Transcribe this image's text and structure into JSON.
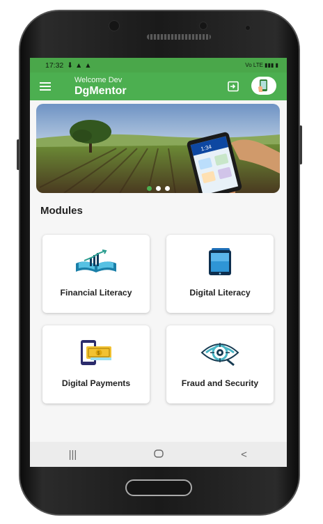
{
  "status_bar": {
    "time": "17:32",
    "left_icons": "⬇ ▲ ▲",
    "right_icons": "Vo LTE ▮▮▮ ▮"
  },
  "app_bar": {
    "welcome": "Welcome Dev",
    "title": "DgMentor"
  },
  "carousel": {
    "page_count": 3,
    "active_page": 1
  },
  "modules": {
    "heading": "Modules",
    "items": [
      {
        "label": "Financial Literacy",
        "icon": "open-book-chart-icon"
      },
      {
        "label": "Digital Literacy",
        "icon": "tablet-icon"
      },
      {
        "label": "Digital Payments",
        "icon": "phone-cash-icon"
      },
      {
        "label": "Fraud and Security",
        "icon": "eye-target-icon"
      }
    ]
  },
  "colors": {
    "accent": "#4caf50",
    "status": "#4aa74a",
    "background": "#f6f6f6"
  }
}
